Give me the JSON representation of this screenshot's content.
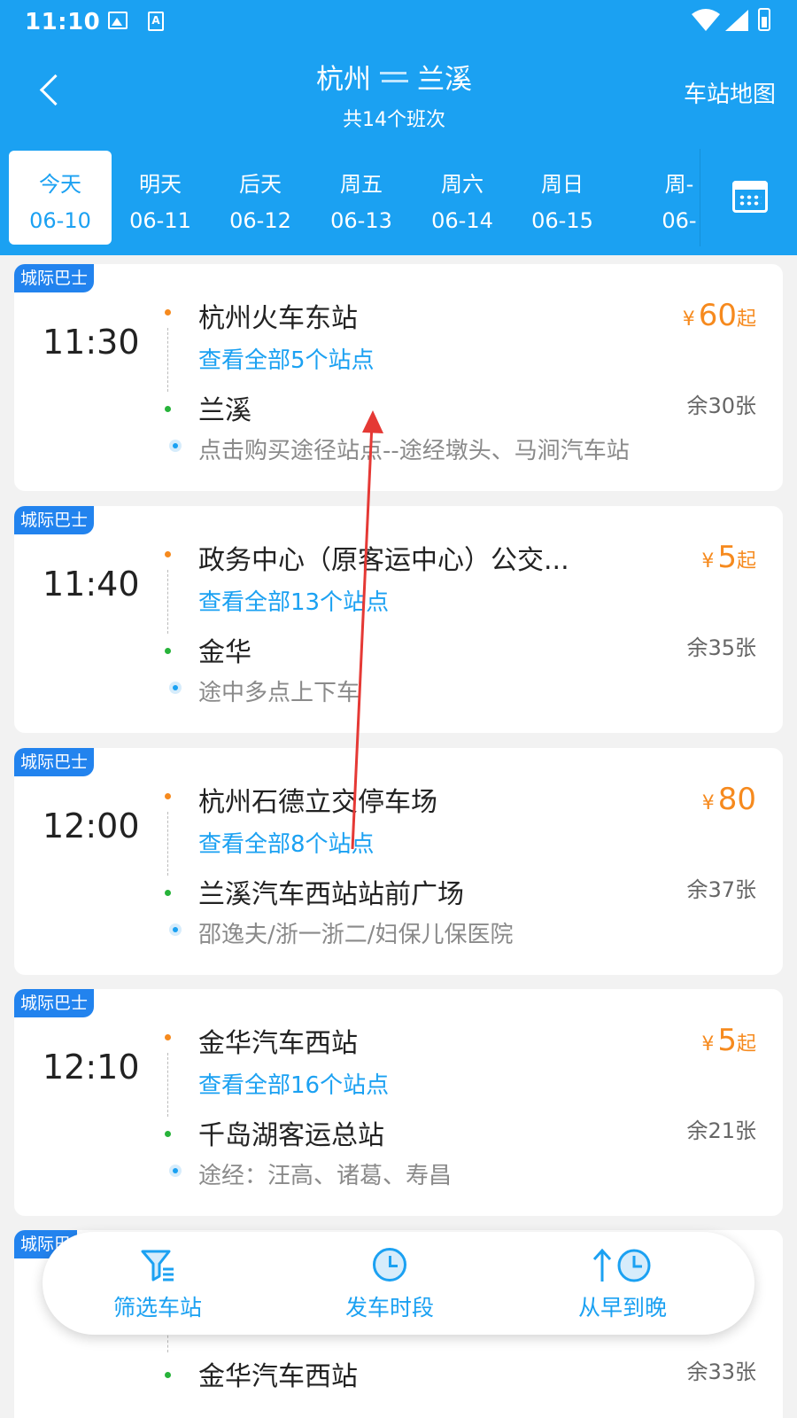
{
  "status_bar": {
    "time": "11:10"
  },
  "header": {
    "from_city": "杭州",
    "to_city": "兰溪",
    "subtitle": "共14个班次",
    "station_map": "车站地图"
  },
  "dates": [
    {
      "day": "今天",
      "date": "06-10",
      "active": true
    },
    {
      "day": "明天",
      "date": "06-11"
    },
    {
      "day": "后天",
      "date": "06-12"
    },
    {
      "day": "周五",
      "date": "06-13"
    },
    {
      "day": "周六",
      "date": "06-14"
    },
    {
      "day": "周日",
      "date": "06-15"
    },
    {
      "day": "周-",
      "date": "06-"
    }
  ],
  "trips": [
    {
      "badge": "城际巴士",
      "time": "11:30",
      "from": "杭州火车东站",
      "stops": "查看全部5个站点",
      "to": "兰溪",
      "note": "点击购买途径站点--途经墩头、马涧汽车站",
      "price": "60",
      "price_suffix": "起",
      "remain": "余30张"
    },
    {
      "badge": "城际巴士",
      "time": "11:40",
      "from": "政务中心（原客运中心）公交...",
      "stops": "查看全部13个站点",
      "to": "金华",
      "note": "途中多点上下车",
      "price": "5",
      "price_suffix": "起",
      "remain": "余35张"
    },
    {
      "badge": "城际巴士",
      "time": "12:00",
      "from": "杭州石德立交停车场",
      "stops": "查看全部8个站点",
      "to": "兰溪汽车西站站前广场",
      "note": "邵逸夫/浙一浙二/妇保儿保医院",
      "price": "80",
      "price_suffix": "",
      "remain": "余37张"
    },
    {
      "badge": "城际巴士",
      "time": "12:10",
      "from": "金华汽车西站",
      "stops": "查看全部16个站点",
      "to": "千岛湖客运总站",
      "note": "途经：汪高、诸葛、寿昌",
      "price": "5",
      "price_suffix": "起",
      "remain": "余21张"
    },
    {
      "badge": "城际巴",
      "to": "金华汽车西站",
      "remain": "余33张"
    }
  ],
  "currency": "¥",
  "bottom_bar": {
    "filter": "筛选车站",
    "time_slot": "发车时段",
    "sort": "从早到晚"
  },
  "colors": {
    "primary": "#1ba1f2",
    "price": "#f68a1e",
    "badge": "#2283ee",
    "arrow": "#e53935"
  }
}
